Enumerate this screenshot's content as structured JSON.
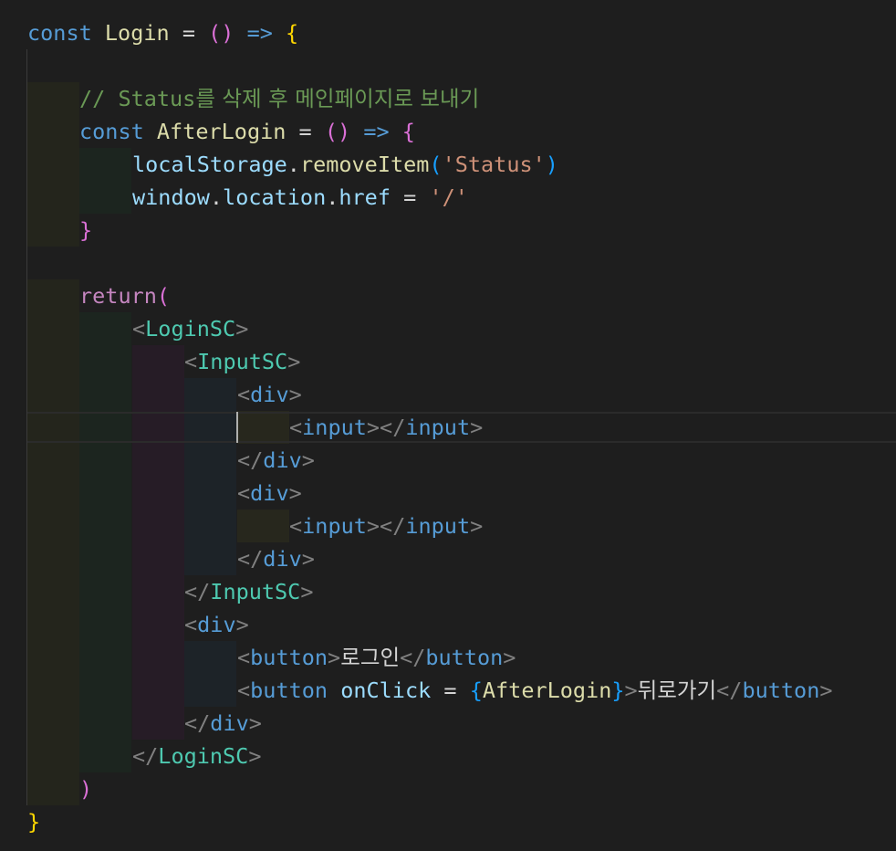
{
  "code": {
    "l1": {
      "const": "const",
      "name": "Login",
      "eq": "=",
      "parens": "()",
      "arrow": "=>",
      "brace": "{"
    },
    "l3": {
      "comment_prefix": "// Status",
      "comment_ko": "를 삭제 후 메인페이지로 보내기"
    },
    "l4": {
      "const": "const",
      "name": "AfterLogin",
      "eq": "=",
      "parens": "()",
      "arrow": "=>",
      "brace": "{"
    },
    "l5": {
      "obj": "localStorage",
      "dot": ".",
      "method": "removeItem",
      "open": "(",
      "arg": "'Status'",
      "close": ")"
    },
    "l6": {
      "obj": "window",
      "dot1": ".",
      "prop1": "location",
      "dot2": ".",
      "prop2": "href",
      "eq": "=",
      "val": "'/'"
    },
    "l7": {
      "brace": "}"
    },
    "l9": {
      "ret": "return",
      "open": "("
    },
    "l10": {
      "lt": "<",
      "tag": "LoginSC",
      "gt": ">"
    },
    "l11": {
      "lt": "<",
      "tag": "InputSC",
      "gt": ">"
    },
    "l12": {
      "lt": "<",
      "tag": "div",
      "gt": ">"
    },
    "l13": {
      "lt": "<",
      "tag": "input",
      "mid": "></",
      "tag2": "input",
      "gt": ">"
    },
    "l14": {
      "lt": "</",
      "tag": "div",
      "gt": ">"
    },
    "l15": {
      "lt": "<",
      "tag": "div",
      "gt": ">"
    },
    "l16": {
      "lt": "<",
      "tag": "input",
      "mid": "></",
      "tag2": "input",
      "gt": ">"
    },
    "l17": {
      "lt": "</",
      "tag": "div",
      "gt": ">"
    },
    "l18": {
      "lt": "</",
      "tag": "InputSC",
      "gt": ">"
    },
    "l19": {
      "lt": "<",
      "tag": "div",
      "gt": ">"
    },
    "l20": {
      "lt": "<",
      "tag": "button",
      "gt": ">",
      "text": "로그인",
      "lt2": "</",
      "tag2": "button",
      "gt2": ">"
    },
    "l21": {
      "lt": "<",
      "tag": "button",
      "attr": "onClick",
      "eq": "=",
      "ob": "{",
      "val": "AfterLogin",
      "cb": "}",
      "gt": ">",
      "text": "뒤로가기",
      "lt2": "</",
      "tag2": "button",
      "gt2": ">"
    },
    "l22": {
      "lt": "</",
      "tag": "div",
      "gt": ">"
    },
    "l23": {
      "lt": "</",
      "tag": "LoginSC",
      "gt": ">"
    },
    "l24": {
      "close": ")"
    },
    "l25": {
      "brace": "}"
    }
  }
}
